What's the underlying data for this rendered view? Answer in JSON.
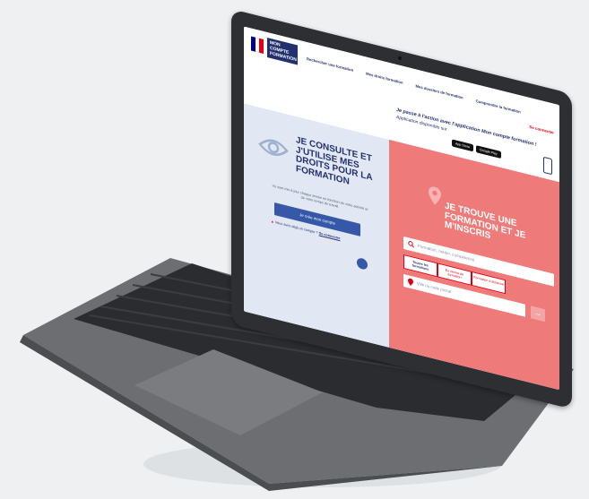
{
  "header": {
    "logo_line1": "MON",
    "logo_line2": "COMPTE",
    "logo_line3": "FORMATION",
    "nav": [
      {
        "label": "Rechercher une formation"
      },
      {
        "label": "Mes droits formation"
      },
      {
        "label": "Mes dossiers de formation"
      },
      {
        "label": "Comprendre la formation"
      }
    ],
    "connect": "Se connecter"
  },
  "promo": {
    "line1": "Je passe à l'action avec l'application Mon compte formation !",
    "line2": "Application disponible sur",
    "app_store": "App Store",
    "google_play": "Google Play"
  },
  "left_panel": {
    "title": "Je consulte et j'utilise mes droits pour la formation",
    "text": "Vu sont mis à jour chaque année en fonction de votre activité et de votre temps de travail.",
    "create_button": "Je crée mon compte",
    "already": "Vous avez déjà un compte ?",
    "already_link": "Se connecter"
  },
  "right_panel": {
    "title": "Je trouve une formation et je m'inscris",
    "search_placeholder": "Formation, métier, compétence",
    "tabs": [
      {
        "label": "Toutes les formations"
      },
      {
        "label": "En centre de formation"
      },
      {
        "label": "Formation à distance"
      }
    ],
    "location_placeholder": "Ville ou code postal",
    "go": "→"
  },
  "colors": {
    "navy": "#22306e",
    "blue": "#3558a8",
    "coral": "#ef7a7a",
    "light_blue_panel": "#e2e8f3",
    "red": "#e1000f"
  }
}
